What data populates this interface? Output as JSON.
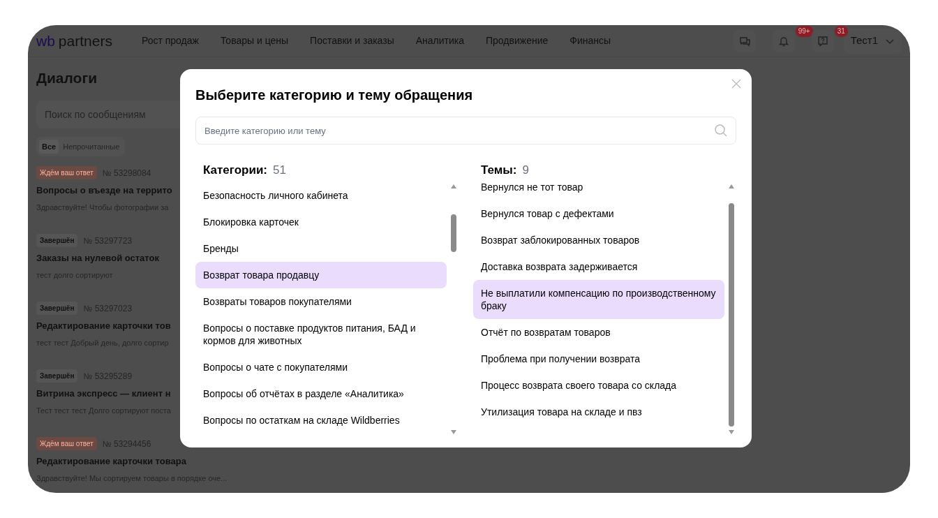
{
  "header": {
    "logo": {
      "first": "wb",
      "second": "partners"
    },
    "nav": [
      "Рост продаж",
      "Товары и цены",
      "Поставки и заказы",
      "Аналитика",
      "Продвижение",
      "Финансы"
    ],
    "icons": [
      {
        "kind": "chats"
      },
      {
        "kind": "bell",
        "badge": "99+"
      },
      {
        "kind": "question",
        "badge": "31"
      }
    ],
    "user": "Тест1"
  },
  "dialogs_panel": {
    "title": "Диалоги",
    "search": {
      "placeholder": "Поиск по сообщениям"
    },
    "filters": [
      {
        "label": "Все",
        "selected": true
      },
      {
        "label": "Непрочитанные",
        "selected": false
      }
    ],
    "items": [
      {
        "status": "Ждём ваш ответ",
        "kind": "waiting",
        "number": "№ 53298084",
        "title": "Вопросы о въезде на террито",
        "preview": "Здравствуйте! Чтобы фотографии за"
      },
      {
        "status": "Завершён",
        "kind": "done",
        "number": "№ 53297723",
        "title": "Заказы на нулевой остаток",
        "preview": "тест долго сортируют"
      },
      {
        "status": "Завершён",
        "kind": "done",
        "number": "№ 53297023",
        "title": "Редактирование карточки тов",
        "preview": "тест тест Добрый день, долго сортир"
      },
      {
        "status": "Завершён",
        "kind": "done",
        "number": "№ 53295289",
        "title": "Витрина экспресс — клиент н",
        "preview": "Тест тест тест Долго сортируют поста"
      },
      {
        "status": "Ждём ваш ответ",
        "kind": "waiting",
        "number": "№ 53294456",
        "title": "Редактирование карточки товара",
        "preview": "Здравствуйте! Мы сортируем товары в порядке оче..."
      }
    ]
  },
  "modal": {
    "title": "Выберите категорию и тему обращения",
    "search": {
      "placeholder": "Введите категорию или тему"
    },
    "categories": {
      "label": "Категории:",
      "count": "51",
      "items": [
        {
          "label": "Безопасность личного кабинета",
          "selected": false
        },
        {
          "label": "Блокировка карточек",
          "selected": false
        },
        {
          "label": "Бренды",
          "selected": false
        },
        {
          "label": "Возврат товара продавцу",
          "selected": true
        },
        {
          "label": "Возвраты товаров покупателями",
          "selected": false
        },
        {
          "label": "Вопросы о поставке продуктов питания, БАД и кормов для животных",
          "selected": false
        },
        {
          "label": "Вопросы о чате с покупателями",
          "selected": false
        },
        {
          "label": "Вопросы об отчётах в разделе «Аналитика»",
          "selected": false
        },
        {
          "label": "Вопросы по остаткам на складе Wildberries",
          "selected": false
        }
      ]
    },
    "topics": {
      "label": "Темы:",
      "count": "9",
      "items": [
        {
          "label": "Вернулся не тот товар",
          "selected": false
        },
        {
          "label": "Вернулся товар с дефектами",
          "selected": false
        },
        {
          "label": "Возврат заблокированных товаров",
          "selected": false
        },
        {
          "label": "Доставка возврата задерживается",
          "selected": false
        },
        {
          "label": "Не выплатили компенсацию по производственному браку",
          "selected": true
        },
        {
          "label": "Отчёт по возвратам товаров",
          "selected": false
        },
        {
          "label": "Проблема при получении возврата",
          "selected": false
        },
        {
          "label": "Процесс возврата своего товара со склада",
          "selected": false
        },
        {
          "label": "Утилизация товара на складе и пвз",
          "selected": false
        }
      ]
    }
  }
}
